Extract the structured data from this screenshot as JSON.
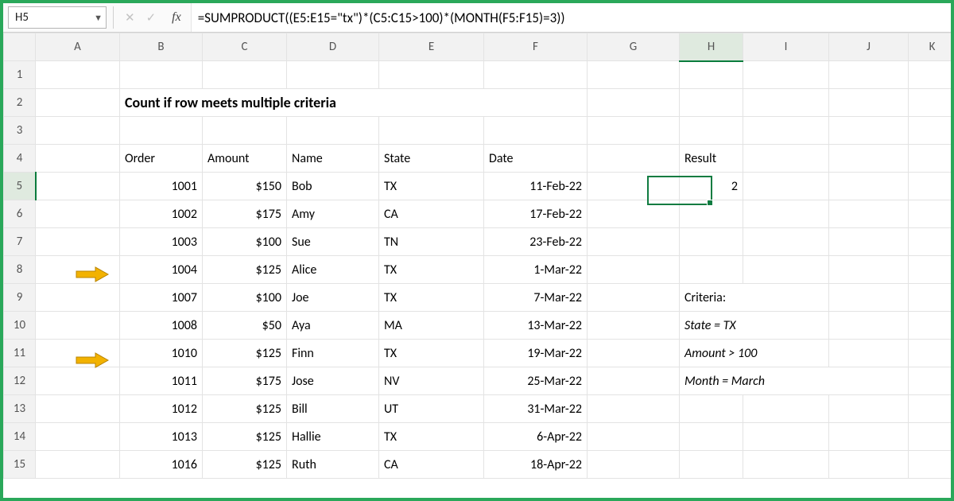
{
  "namebox": {
    "ref": "H5"
  },
  "formula_bar": {
    "fx_label": "fx",
    "value": "=SUMPRODUCT((E5:E15=\"tx\")*(C5:C15>100)*(MONTH(F5:F15)=3))"
  },
  "columns": [
    "A",
    "B",
    "C",
    "D",
    "E",
    "F",
    "G",
    "H",
    "I",
    "J",
    "K"
  ],
  "rows": [
    "1",
    "2",
    "3",
    "4",
    "5",
    "6",
    "7",
    "8",
    "9",
    "10",
    "11",
    "12",
    "13",
    "14",
    "15"
  ],
  "title": "Count if row meets multiple criteria",
  "headers": {
    "order": "Order",
    "amount": "Amount",
    "name": "Name",
    "state": "State",
    "date": "Date"
  },
  "data": [
    {
      "order": "1001",
      "amount": "$150",
      "name": "Bob",
      "state": "TX",
      "date": "11-Feb-22"
    },
    {
      "order": "1002",
      "amount": "$175",
      "name": "Amy",
      "state": "CA",
      "date": "17-Feb-22"
    },
    {
      "order": "1003",
      "amount": "$100",
      "name": "Sue",
      "state": "TN",
      "date": "23-Feb-22"
    },
    {
      "order": "1004",
      "amount": "$125",
      "name": "Alice",
      "state": "TX",
      "date": "1-Mar-22"
    },
    {
      "order": "1007",
      "amount": "$100",
      "name": "Joe",
      "state": "TX",
      "date": "7-Mar-22"
    },
    {
      "order": "1008",
      "amount": "$50",
      "name": "Aya",
      "state": "MA",
      "date": "13-Mar-22"
    },
    {
      "order": "1010",
      "amount": "$125",
      "name": "Finn",
      "state": "TX",
      "date": "19-Mar-22"
    },
    {
      "order": "1011",
      "amount": "$175",
      "name": "Jose",
      "state": "NV",
      "date": "25-Mar-22"
    },
    {
      "order": "1012",
      "amount": "$125",
      "name": "Bill",
      "state": "UT",
      "date": "31-Mar-22"
    },
    {
      "order": "1013",
      "amount": "$125",
      "name": "Hallie",
      "state": "TX",
      "date": "6-Apr-22"
    },
    {
      "order": "1016",
      "amount": "$125",
      "name": "Ruth",
      "state": "CA",
      "date": "18-Apr-22"
    }
  ],
  "result": {
    "label": "Result",
    "value": "2"
  },
  "criteria": {
    "heading": "Criteria:",
    "lines": [
      "State = TX",
      "Amount > 100",
      "Month = March"
    ]
  },
  "selection": {
    "col": "H",
    "row": "5"
  },
  "colors": {
    "arrow": "#f2b200",
    "select": "#107c41"
  }
}
